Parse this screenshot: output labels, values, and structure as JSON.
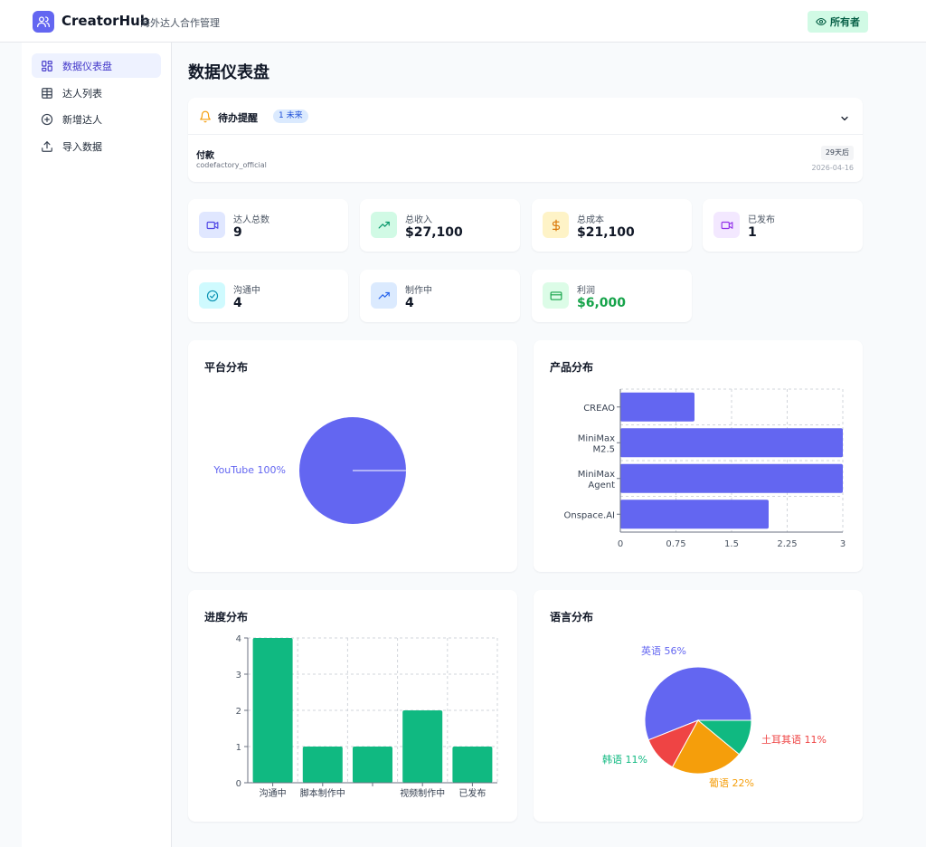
{
  "app": {
    "name": "CreatorHub",
    "subtitle": "海外达人合作管理",
    "role": "所有者"
  },
  "sidebar": {
    "items": [
      {
        "label": "数据仪表盘",
        "icon": "dashboard-icon",
        "active": true
      },
      {
        "label": "达人列表",
        "icon": "table-icon",
        "active": false
      },
      {
        "label": "新增达人",
        "icon": "plus-circle-icon",
        "active": false
      },
      {
        "label": "导入数据",
        "icon": "upload-icon",
        "active": false
      }
    ]
  },
  "page": {
    "title": "数据仪表盘"
  },
  "reminders": {
    "title": "待办提醒",
    "badge": "1 未来",
    "items": [
      {
        "name": "付款",
        "handle": "codefactory_official",
        "days": "29天后",
        "date": "2026-04-16"
      }
    ]
  },
  "stats": [
    {
      "label": "达人总数",
      "value": "9",
      "icon": "video-icon",
      "bg": "#e0e7ff",
      "fg": "#4f46e5"
    },
    {
      "label": "总收入",
      "value": "$27,100",
      "icon": "trending-up-icon",
      "bg": "#d1fae5",
      "fg": "#059669"
    },
    {
      "label": "总成本",
      "value": "$21,100",
      "icon": "dollar-icon",
      "bg": "#fef3c7",
      "fg": "#d97706"
    },
    {
      "label": "已发布",
      "value": "1",
      "icon": "video-icon",
      "bg": "#f3e8ff",
      "fg": "#9333ea"
    },
    {
      "label": "沟通中",
      "value": "4",
      "icon": "check-circle-icon",
      "bg": "#cffafe",
      "fg": "#0891b2"
    },
    {
      "label": "制作中",
      "value": "4",
      "icon": "trending-up-icon",
      "bg": "#dbeafe",
      "fg": "#2563eb"
    },
    {
      "label": "利润",
      "value": "$6,000",
      "icon": "credit-card-icon",
      "bg": "#dcfce7",
      "fg": "#16a34a",
      "value_color": "#16a34a"
    }
  ],
  "chart_data": [
    {
      "type": "pie",
      "title": "平台分布",
      "slices": [
        {
          "label": "YouTube",
          "value": 100,
          "display": "YouTube 100%",
          "color": "#6366f1"
        }
      ]
    },
    {
      "type": "bar",
      "orientation": "horizontal",
      "title": "产品分布",
      "categories": [
        [
          "CREAO"
        ],
        [
          "MiniMax",
          "M2.5"
        ],
        [
          "MiniMax",
          "Agent"
        ],
        [
          "Onspace.AI"
        ]
      ],
      "values": [
        1,
        3,
        3,
        2
      ],
      "ticks": [
        "0",
        "0.75",
        "1.5",
        "2.25",
        "3"
      ],
      "xlim": [
        0,
        3
      ],
      "color": "#6366f1",
      "grid": true
    },
    {
      "type": "bar",
      "title": "进度分布",
      "categories": [
        "沟通中",
        "脚本制作中",
        "",
        "视频制作中",
        "已发布"
      ],
      "values": [
        4,
        1,
        1,
        2,
        1
      ],
      "ticks": [
        "0",
        "1",
        "2",
        "3",
        "4"
      ],
      "ylim": [
        0,
        4
      ],
      "color": "#10b981",
      "grid": true
    },
    {
      "type": "pie",
      "title": "语言分布",
      "slices": [
        {
          "label": "英语",
          "value": 56,
          "display": "英语 56%",
          "color": "#6366f1"
        },
        {
          "label": "土耳其语",
          "value": 11,
          "display": "土耳其语 11%",
          "color": "#ef4444"
        },
        {
          "label": "葡语",
          "value": 22,
          "display": "葡语 22%",
          "color": "#f59e0b"
        },
        {
          "label": "韩语",
          "value": 11,
          "display": "韩语 11%",
          "color": "#10b981"
        }
      ]
    }
  ]
}
